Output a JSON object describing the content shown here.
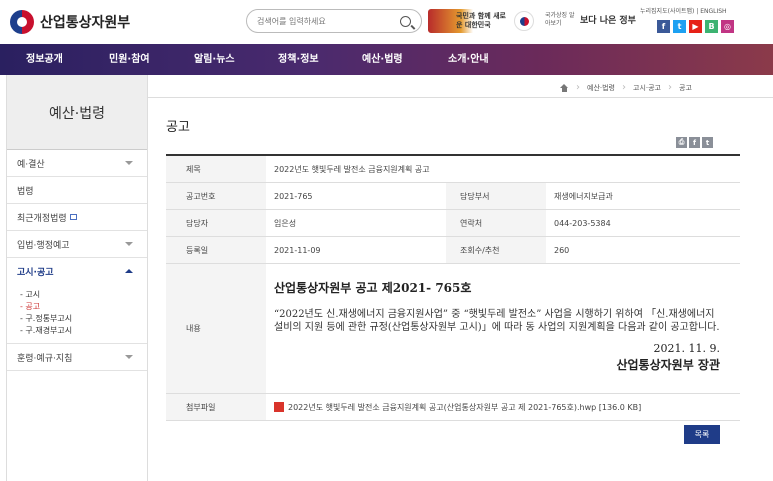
{
  "header": {
    "logo_text": "산업통상자원부",
    "search_placeholder": "검색어를 입력하세요",
    "banner_text": "국민과 함께 새로운 대한민국",
    "flag_label": "국가상징 알아보기",
    "better_gov": "보다 나은 정부",
    "top_links": "누리집지도(사이트맵) | ENGLISH",
    "sns": [
      {
        "icon": "facebook-icon",
        "glyph": "f",
        "color": "#3b5998"
      },
      {
        "icon": "twitter-icon",
        "glyph": "t",
        "color": "#1da1f2"
      },
      {
        "icon": "youtube-icon",
        "glyph": "▶",
        "color": "#e62117"
      },
      {
        "icon": "blog-icon",
        "glyph": "B",
        "color": "#3cb371"
      },
      {
        "icon": "instagram-icon",
        "glyph": "◎",
        "color": "#c13584"
      }
    ]
  },
  "gnb": [
    "정보공개",
    "민원·참여",
    "알림·뉴스",
    "정책·정보",
    "예산·법령",
    "소개·안내"
  ],
  "sidebar": {
    "title": "예산·법령",
    "items": [
      {
        "label": "예·결산",
        "arrow": true
      },
      {
        "label": "법령",
        "arrow": false
      },
      {
        "label": "최근개정법령",
        "arrow": false,
        "external": true
      },
      {
        "label": "입법·행정예고",
        "arrow": true
      },
      {
        "label": "고시·공고",
        "arrow": true,
        "active": true
      }
    ],
    "sub_items": [
      "- 고시",
      "- 공고",
      "- 구.정통부고시",
      "- 구.재경부고시"
    ],
    "last_item": "훈령·예규·지침"
  },
  "breadcrumb": [
    "예산·법령",
    "고시·공고",
    "공고"
  ],
  "page_title": "공고",
  "detail": {
    "title_label": "제목",
    "title_value": "2022년도 햇빛두레 발전소 금융지원계획 공고",
    "number_label": "공고번호",
    "number_value": "2021-765",
    "dept_label": "담당부서",
    "dept_value": "재생에너지보급과",
    "manager_label": "담당자",
    "manager_value": "임은성",
    "phone_label": "연락처",
    "phone_value": "044-203-5384",
    "date_label": "등록일",
    "date_value": "2021-11-09",
    "views_label": "조회수/추천",
    "views_value": "260",
    "content_label": "내용",
    "notice_title": "산업통상자원부 공고 제2021- 765호",
    "notice_body": "“2022년도 신.재생에너지 금융지원사업” 중 “햇빛두레 발전소” 사업을 시행하기 위하여 「신.재생에너지 설비의 지원 등에 관한 규정(산업통상자원부 고시)」에 따라 동 사업의 지원계획을 다음과 같이 공고합니다.",
    "notice_date": "2021. 11. 9.",
    "notice_sign": "산업통상자원부 장관",
    "attach_label": "첨부파일",
    "attach_value": "2022년도 햇빛두레 발전소 금융지원계획 공고(산업통상자원부 공고 제 2021-765호).hwp [136.0 KB]"
  },
  "list_button": "목록"
}
